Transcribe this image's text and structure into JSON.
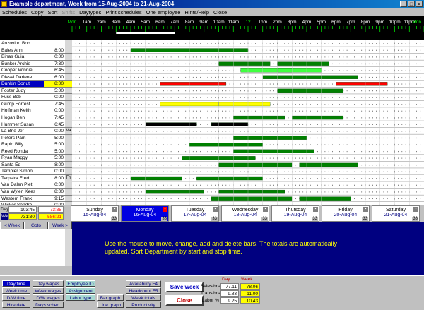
{
  "window": {
    "title": "Example department,  Week from 15-Aug-2004  to  21-Aug-2004"
  },
  "menu": [
    "Schedules",
    "Copy",
    "Sort",
    "Shifts",
    "Daytypes",
    "Print schedules",
    "One employee",
    "Hints/Help",
    "Close"
  ],
  "hour_labels": [
    "Mdn",
    "1am",
    "2am",
    "3am",
    "4am",
    "5am",
    "6am",
    "7am",
    "8am",
    "9am",
    "10am",
    "11am",
    "12",
    "1pm",
    "2pm",
    "3pm",
    "4pm",
    "5pm",
    "6pm",
    "7pm",
    "8pm",
    "9pm",
    "10pm",
    "11pm",
    "Mdn"
  ],
  "employees": [
    {
      "name": "Anzovino Bob",
      "hours": "",
      "flag": ""
    },
    {
      "name": "Bales Ann",
      "hours": "8:00",
      "flag": "",
      "bars": [
        [
          4,
          8,
          "dg"
        ],
        [
          8,
          12,
          "dg"
        ]
      ]
    },
    {
      "name": "Binas Guia",
      "hours": "0:00",
      "flag": ""
    },
    {
      "name": "Bunker Archie",
      "hours": "7:30",
      "flag": "",
      "bars": [
        [
          10,
          13.5,
          "dg"
        ],
        [
          14,
          17.5,
          "dg"
        ]
      ]
    },
    {
      "name": "Cooper Winnie",
      "hours": "6:45",
      "flag": "",
      "bars": [
        [
          11.5,
          15,
          "lg"
        ],
        [
          14,
          17,
          "lg"
        ]
      ]
    },
    {
      "name": "Diesel Darlene",
      "hours": "6:00",
      "flag": "",
      "bars": [
        [
          13,
          17,
          "dg"
        ],
        [
          17,
          19.5,
          "dg"
        ]
      ]
    },
    {
      "name": "Dunkin Donut",
      "hours": "8:00",
      "flag": "",
      "sel": true,
      "hl": true,
      "bars": [
        [
          6,
          10.5,
          "red"
        ],
        [
          18,
          21.5,
          "red"
        ]
      ]
    },
    {
      "name": "Foster Judy",
      "hours": "5:00",
      "flag": "",
      "bars": [
        [
          14,
          18.5,
          "dg"
        ]
      ]
    },
    {
      "name": "Fuss Bob",
      "hours": "0:00",
      "flag": ""
    },
    {
      "name": "Gump Forrest",
      "hours": "7:45",
      "flag": "",
      "bars": [
        [
          6,
          10,
          "yel"
        ],
        [
          10,
          13.5,
          "yel"
        ]
      ]
    },
    {
      "name": "Hoffman Keith",
      "hours": "0:00",
      "flag": ""
    },
    {
      "name": "Hogan Ben",
      "hours": "7:45",
      "flag": "",
      "bars": [
        [
          11,
          14.5,
          "dg"
        ],
        [
          15,
          18.5,
          "dg"
        ]
      ]
    },
    {
      "name": "Hummer Susan",
      "hours": "6:45",
      "flag": "",
      "bars": [
        [
          5,
          8.5,
          "blk"
        ],
        [
          9.5,
          12,
          "blk"
        ]
      ]
    },
    {
      "name": "La Brie Jef",
      "hours": "0:00",
      "flag": "Va"
    },
    {
      "name": "Peters Pam",
      "hours": "5:00",
      "flag": "",
      "bars": [
        [
          11,
          16,
          "dg"
        ]
      ]
    },
    {
      "name": "Rapid Billy",
      "hours": "5:00",
      "flag": "",
      "bars": [
        [
          8,
          13,
          "dg"
        ]
      ]
    },
    {
      "name": "Reed Ronda",
      "hours": "5:00",
      "flag": "",
      "bars": [
        [
          11,
          16.5,
          "dg"
        ]
      ]
    },
    {
      "name": "Ryan Maggy",
      "hours": "5:00",
      "flag": "",
      "bars": [
        [
          7.5,
          12.5,
          "dg"
        ]
      ]
    },
    {
      "name": "Santa Ed",
      "hours": "8:00",
      "flag": "",
      "bars": [
        [
          10,
          15,
          "dg"
        ],
        [
          15.5,
          19.5,
          "dg"
        ]
      ]
    },
    {
      "name": "Templer Simon",
      "hours": "0:00",
      "flag": ""
    },
    {
      "name": "Terpstra Fred",
      "hours": "8:00",
      "flag": "Fh",
      "bars": [
        [
          4,
          7.5,
          "dg"
        ],
        [
          8.5,
          13,
          "dg"
        ]
      ]
    },
    {
      "name": "Van Dalen Piet",
      "hours": "0:00",
      "flag": ""
    },
    {
      "name": "Van Wylen Kees",
      "hours": "8:00",
      "flag": "",
      "bars": [
        [
          5,
          9,
          "dg"
        ],
        [
          10,
          14.5,
          "dg"
        ]
      ]
    },
    {
      "name": "Western Frank",
      "hours": "9:15",
      "flag": "",
      "bars": [
        [
          9.5,
          15,
          "dg"
        ],
        [
          15.5,
          19,
          "dg"
        ]
      ]
    },
    {
      "name": "Wicker Sandra",
      "hours": "0:00",
      "flag": ""
    }
  ],
  "totals": {
    "day_label": "Day",
    "day_value": "103:45",
    "day_red": "73:35",
    "wk_label": "Wk",
    "wk_value": "731:30",
    "wk_red": "586:21"
  },
  "nav": {
    "prev": "< Week",
    "goto": "Goto",
    "next": "Week >"
  },
  "days": [
    {
      "name": "Sunday",
      "date": "15-Aug-04",
      "count": "33"
    },
    {
      "name": "Monday",
      "date": "16-Aug-04",
      "count": "33",
      "sel": true
    },
    {
      "name": "Tuesday",
      "date": "17-Aug-04",
      "count": "33"
    },
    {
      "name": "Wednesday",
      "date": "18-Aug-04",
      "count": "33"
    },
    {
      "name": "Thursday",
      "date": "19-Aug-04",
      "count": "33"
    },
    {
      "name": "Friday",
      "date": "20-Aug-04",
      "count": "33"
    },
    {
      "name": "Saturday",
      "date": "21-Aug-04",
      "count": "33"
    }
  ],
  "info": "Use the mouse to move, change, add and delete bars.  The totals are automatically updated.  Sort Department by start and stop time.",
  "bottom": {
    "day_time": "Day time",
    "week_time": "Week time",
    "dw_time": "D/W time",
    "hire_date": "Hire date",
    "day_wages": "Day wages",
    "week_wages": "Week wages",
    "dw_wages": "D/W wages",
    "days_sched": "Days sched.",
    "employee_id": "Employee ID",
    "assignment": "Assignment",
    "labor_type": "Labor type",
    "bar_graph": "Bar graph",
    "line_graph": "Line graph",
    "availability": "Availability   F4",
    "headcount": "Headcount  F5",
    "week_totals": "Week totals",
    "productivity": "Productivity",
    "save_week": "Save week",
    "close": "Close",
    "col_day": "Day",
    "col_week": "Week",
    "sales_label": "Sales/hrs",
    "sales_day": "77.11",
    "sales_week": "78.06",
    "trans_label": "Trans/hrs",
    "trans_day": "9.83",
    "trans_week": "11.00",
    "labor_label": "Labor %",
    "labor_day": "9.25",
    "labor_week": "10.43"
  },
  "colors": {
    "dg": "#008000",
    "lg": "#40ff40",
    "red": "#ff0000",
    "yel": "#ffff00",
    "blk": "#000000"
  }
}
